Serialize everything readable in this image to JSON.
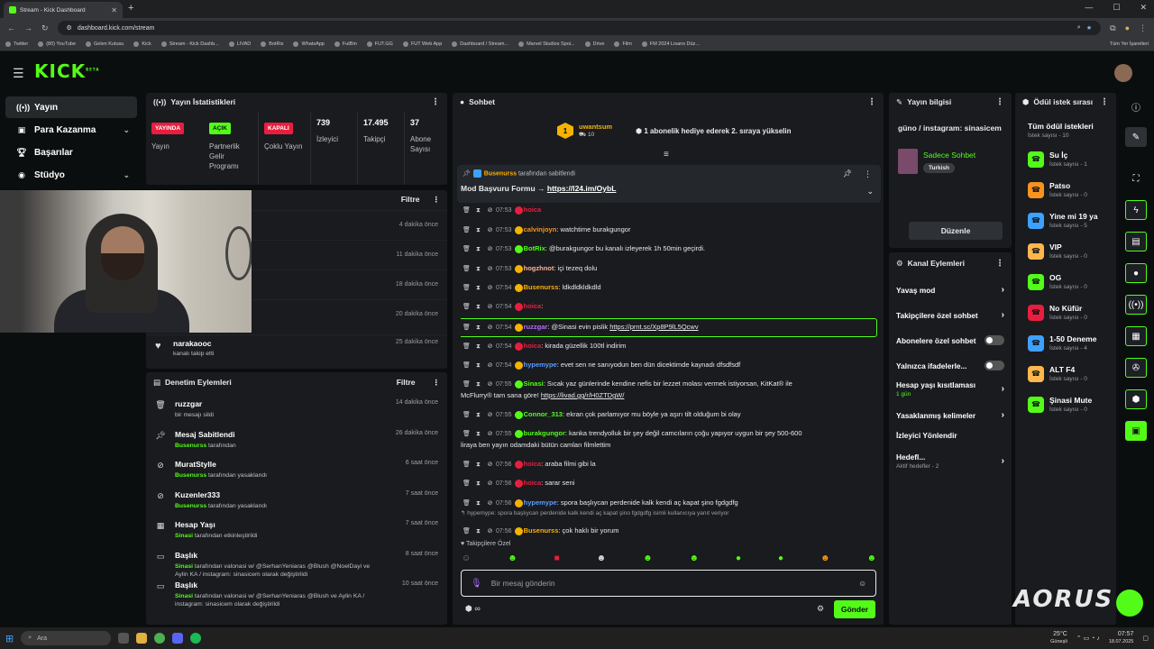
{
  "browser": {
    "tab_title": "Stream - Kick Dashboard",
    "url": "dashboard.kick.com/stream",
    "bookmarks": [
      "Twitter",
      "(80) YouTube",
      "Gelen Kutusu",
      "Kick",
      "Stream - Kick Dashb...",
      "LIVAD",
      "BotRix",
      "WhatsApp",
      "FutBin",
      "FUT.GG",
      "FUT Web App",
      "Dashboard / Stream...",
      "Marvel Studios Spoi...",
      "Drive",
      "Film",
      "FM 2024 Lisans Düz..."
    ],
    "all_bookmarks": "Tüm Yer İşaretleri"
  },
  "brand": {
    "logo": "KICK",
    "beta": "BETA"
  },
  "sidebar": {
    "items": [
      {
        "label": "Yayın",
        "icon": "broadcast-icon"
      },
      {
        "label": "Para Kazanma",
        "icon": "dollar-icon"
      },
      {
        "label": "Başarılar",
        "icon": "trophy-icon"
      },
      {
        "label": "Stüdyo",
        "icon": "palette-icon"
      }
    ]
  },
  "stats": {
    "title": "Yayın İstatistikleri",
    "cells": [
      {
        "badge": "YAYINDA",
        "label": "Yayın",
        "color": "#e91e3f"
      },
      {
        "badge": "AÇIK",
        "label": "Partnerlik Gelir Programı",
        "color": "#53fc18"
      },
      {
        "badge": "KAPALI",
        "label": "Çoklu Yayın",
        "color": "#e91e3f"
      },
      {
        "num": "739",
        "label": "İzleyici"
      },
      {
        "num": "17.495",
        "label": "Takipçi"
      },
      {
        "num": "37",
        "label": "Abone Sayısı"
      }
    ]
  },
  "feed": {
    "filter": "Filtre",
    "rows": [
      {
        "time": "4 dakika önce"
      },
      {
        "time": "11 dakika önce"
      },
      {
        "time": "18 dakika önce"
      },
      {
        "time": "20 dakika önce"
      },
      {
        "user": "narakaooc",
        "text": "kanalı takip etti",
        "time": "25 dakika önce"
      }
    ]
  },
  "mod": {
    "title": "Denetim Eylemleri",
    "filter": "Filtre",
    "rows": [
      {
        "title": "ruzzgar",
        "sub": "bir mesajı sildi",
        "time": "14 dakika önce",
        "icon": "trash-icon"
      },
      {
        "title": "Mesaj Sabitlendi",
        "actor": "Busenurss",
        "sub": "tarafından",
        "time": "26 dakika önce",
        "icon": "pin-icon"
      },
      {
        "title": "MuratStylle",
        "actor": "Busenurss",
        "sub": "tarafından yasaklandı",
        "time": "6 saat önce",
        "icon": "ban-icon"
      },
      {
        "title": "Kuzenler333",
        "actor": "Busenurss",
        "sub": "tarafından yasaklandı",
        "time": "7 saat önce",
        "icon": "ban-icon"
      },
      {
        "title": "Hesap Yaşı",
        "actor": "Sinasi",
        "sub": "tarafından etkinleştirildi",
        "time": "7 saat önce",
        "icon": "calendar-icon"
      },
      {
        "title": "Başlık",
        "actor": "Sinasi",
        "sub": "tarafından valonasi w/ @SerhanYeniaras @Blush @NoelDayi ve Aylin KA / instagram: sinasicem olarak değiştirildi",
        "time": "8 saat önce",
        "icon": "title-icon"
      },
      {
        "title": "Başlık",
        "actor": "Sinasi",
        "sub": "tarafından valonasi w/ @SerhanYeniaras @Blush ve Aylin KA / instagram: sinasicem olarak değiştirildi",
        "time": "10 saat önce",
        "icon": "title-icon"
      }
    ]
  },
  "chat": {
    "title": "Sohbet",
    "gift_user": "uwantsum",
    "gift_count": "10",
    "gift_text": "1 abonelik hediye ederek 2. sıraya yükselin",
    "pinned_by": "Busenurss",
    "pinned_suffix": "tarafından sabitlendi",
    "pinned_text": "Mod Başvuru Formu → ",
    "pinned_link": "https://l24.im/OybL",
    "messages": [
      {
        "time": "07:53",
        "user": "hoica",
        "text": "",
        "color": "#e91e3f"
      },
      {
        "time": "07:53",
        "user": "calvinjoyn",
        "text": ": watchtime burakgungor",
        "color": "#f7931e"
      },
      {
        "time": "07:53",
        "user": "BotRix",
        "text": ": @burakgungor bu kanalı izleyerek 1h 50min geçirdi.",
        "color": "#53fc18"
      },
      {
        "time": "07:53",
        "user": "hogzhnot",
        "text": ": içi tezeq dolu",
        "color": "#ffb199"
      },
      {
        "time": "07:54",
        "user": "Busenurss",
        "text": ": ldkdldkldkdld",
        "color": "#ffb000"
      },
      {
        "time": "07:54",
        "user": "hoica",
        "text": ":",
        "color": "#e91e3f"
      },
      {
        "time": "07:54",
        "user": "ruzzgar",
        "text": ": @Sinasi evin pislik ",
        "link": "https://prnt.sc/Xp8P9lL5Qcwv",
        "color": "#b36bff"
      },
      {
        "time": "07:54",
        "user": "hoica",
        "text": ": kirada güzellik 100tl indirim",
        "color": "#e91e3f"
      },
      {
        "time": "07:54",
        "user": "hypemype",
        "text": ": evet sen ne sanıyodun ben dün dicektimde kaynadı dfsdfsdf",
        "color": "#5b9bff"
      },
      {
        "time": "07:55",
        "user": "Sinasi",
        "text": ": Sıcak yaz günlerinde kendine nefis bir lezzet molası vermek istiyorsan, KitKat® ile",
        "text2": "McFlurry® tam sana göre! ",
        "link": "https://livad.gg/r/H0ZTDgW/",
        "color": "#53fc18"
      },
      {
        "time": "07:55",
        "user": "Connor_313",
        "text": ": ekran çok parlamıyor mu böyle ya aşırı tilt olduğum bi olay",
        "color": "#53fc18"
      },
      {
        "time": "07:55",
        "user": "burakgungor",
        "text": ": kanka trendyolluk bir şey değil camcıların çoğu yapıyor uygun bir şey 500-600",
        "text2": "liraya ben yayın odamdaki bütün camları filmlettim",
        "color": "#53fc18"
      },
      {
        "time": "07:56",
        "user": "hoica",
        "text": ": araba filmi gibi la",
        "color": "#e91e3f"
      },
      {
        "time": "07:56",
        "user": "hoica",
        "text": ": sarar seni",
        "color": "#e91e3f"
      },
      {
        "time": "07:56",
        "user": "hypemype",
        "text": ": spora başlıycan perdenide kalk kendi aç kapat şino fgdgdfg",
        "color": "#5b9bff"
      },
      {
        "time": "07:56",
        "user": "Busenurss",
        "text": ": çok haklı bir yorum",
        "color": "#ffb000"
      }
    ],
    "reply_hint": "hypemype: spora başlıycan perdenide kalk kendi aç kapat şino fgdgdfg isimli kullanıcıya yanıt veriyor",
    "followers_only": "Takipçilere Özel",
    "input_placeholder": "Bir mesaj gönderin",
    "send": "Gönder"
  },
  "stream_info": {
    "title": "Yayın bilgisi",
    "stream_title": "güno / instagram: sinasicem",
    "category": "Sadece Sohbet",
    "tag": "Turkish",
    "edit": "Düzenle"
  },
  "actions": {
    "title": "Kanal Eylemleri",
    "rows": [
      {
        "label": "Yavaş mod",
        "type": "chev"
      },
      {
        "label": "Takipçilere özel sohbet",
        "type": "chev"
      },
      {
        "label": "Abonelere özel sohbet",
        "type": "toggle"
      },
      {
        "label": "Yalnızca ifadelerle...",
        "type": "toggle"
      },
      {
        "label": "Hesap yaşı kısıtlaması",
        "sub": "1 gün",
        "type": "chev"
      },
      {
        "label": "Yasaklanmış kelimeler",
        "type": "chev"
      },
      {
        "label": "İzleyici Yönlendir",
        "type": "none"
      },
      {
        "label": "Hedefl...",
        "sub": "Aktif hedefler - 2",
        "type": "chev"
      }
    ]
  },
  "rewards": {
    "title": "Ödül istek sırası",
    "all": "Tüm ödül istekleri",
    "all_count": "İstek sayısı - 10",
    "items": [
      {
        "name": "Su İç",
        "count": "İstek sayısı - 1",
        "color": "#53fc18"
      },
      {
        "name": "Patso",
        "count": "İstek sayısı - 0",
        "color": "#f7931e"
      },
      {
        "name": "Yine mi 19 ya",
        "count": "İstek sayısı - 5",
        "color": "#3ea1ff"
      },
      {
        "name": "VIP",
        "count": "İstek sayısı - 0",
        "color": "#ffb74d"
      },
      {
        "name": "OG",
        "count": "İstek sayısı - 0",
        "color": "#53fc18"
      },
      {
        "name": "No Küfür",
        "count": "İstek sayısı - 0",
        "color": "#e91e3f"
      },
      {
        "name": "1-50 Deneme",
        "count": "İstek sayısı - 4",
        "color": "#3ea1ff"
      },
      {
        "name": "ALT F4",
        "count": "İstek sayısı - 0",
        "color": "#ffb74d"
      },
      {
        "name": "Şinasi Mute",
        "count": "İstek sayısı - 0",
        "color": "#53fc18"
      }
    ]
  },
  "taskbar": {
    "search": "Ara",
    "temp": "25°C",
    "weather": "Güneşli",
    "time": "07:57",
    "date": "18.07.2025"
  },
  "watermark": "AORUS"
}
